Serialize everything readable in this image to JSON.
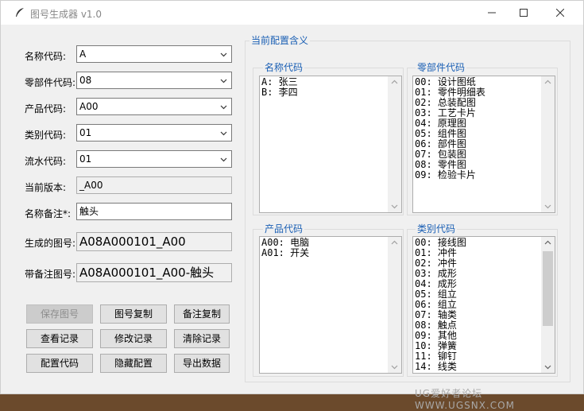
{
  "window": {
    "title": "图号生成器 v1.0"
  },
  "form": {
    "name_code": {
      "label": "名称代码:",
      "value": "A"
    },
    "part_code": {
      "label": "零部件代码:",
      "value": "08"
    },
    "product_code": {
      "label": "产品代码:",
      "value": "A00"
    },
    "category_code": {
      "label": "类别代码:",
      "value": "01"
    },
    "serial_code": {
      "label": "流水代码:",
      "value": "01"
    },
    "current_version": {
      "label": "当前版本:",
      "value": "_A00"
    },
    "name_note": {
      "label": "名称备注*:",
      "value": "触头"
    },
    "generated_number": {
      "label": "生成的图号:",
      "value": "A08A000101_A00"
    },
    "noted_number": {
      "label": "带备注图号:",
      "value": "A08A000101_A00-触头"
    }
  },
  "buttons": {
    "save": "保存图号",
    "copy_number": "图号复制",
    "copy_note": "备注复制",
    "view_records": "查看记录",
    "edit_records": "修改记录",
    "clear_records": "清除记录",
    "config_code": "配置代码",
    "hide_config": "隐藏配置",
    "export_data": "导出数据"
  },
  "config_panel": {
    "title": "当前配置含义",
    "name_code": {
      "title": "名称代码",
      "items": [
        "A: 张三",
        "B: 李四"
      ]
    },
    "part_code": {
      "title": "零部件代码",
      "items": [
        "00: 设计图纸",
        "01: 零件明细表",
        "02: 总装配图",
        "03: 工艺卡片",
        "04: 原理图",
        "05: 组件图",
        "06: 部件图",
        "07: 包装图",
        "08: 零件图",
        "09: 检验卡片"
      ]
    },
    "product_code": {
      "title": "产品代码",
      "items": [
        "A00: 电脑",
        "A01: 开关"
      ]
    },
    "category_code": {
      "title": "类别代码",
      "items": [
        "00: 接线图",
        "01: 冲件",
        "02: 冲件",
        "03: 成形",
        "04: 成形",
        "05: 组立",
        "06: 组立",
        "07: 轴类",
        "08: 触点",
        "09: 其他",
        "10: 弹簧",
        "11: 铆钉",
        "14: 线类"
      ]
    }
  },
  "watermark": "UG爱好者论坛 WWW.UGSNX.COM"
}
